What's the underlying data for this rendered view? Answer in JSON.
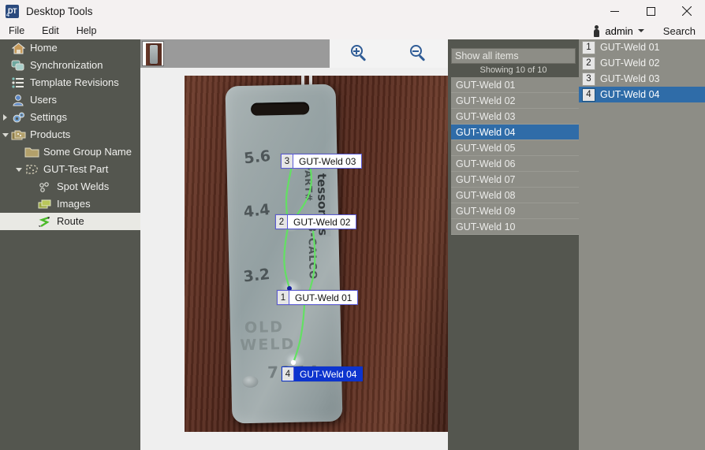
{
  "window": {
    "title": "Desktop Tools",
    "app_icon": "desktop-tools-icon",
    "icon_text": "DT",
    "icon_sub": "4",
    "minimize": "minimize-icon",
    "maximize": "maximize-icon",
    "close": "close-icon"
  },
  "menubar": {
    "items": [
      {
        "label": "File"
      },
      {
        "label": "Edit"
      },
      {
        "label": "Help"
      }
    ],
    "user": "admin",
    "search": "Search"
  },
  "sidebar": {
    "items": [
      {
        "label": "Home",
        "icon": "home-icon",
        "indent": 0,
        "arrow": "none",
        "selected": false
      },
      {
        "label": "Synchronization",
        "icon": "sync-icon",
        "indent": 0,
        "arrow": "none",
        "selected": false
      },
      {
        "label": "Template Revisions",
        "icon": "list-icon",
        "indent": 0,
        "arrow": "none",
        "selected": false
      },
      {
        "label": "Users",
        "icon": "user-icon",
        "indent": 0,
        "arrow": "none",
        "selected": false
      },
      {
        "label": "Settings",
        "icon": "gear-icon",
        "indent": 0,
        "arrow": "right",
        "selected": false
      },
      {
        "label": "Products",
        "icon": "products-icon",
        "indent": 0,
        "arrow": "down",
        "selected": false
      },
      {
        "label": "Some Group Name",
        "icon": "folder-icon",
        "indent": 1,
        "arrow": "none",
        "selected": false
      },
      {
        "label": "GUT-Test Part",
        "icon": "part-icon",
        "indent": 1,
        "arrow": "down",
        "selected": false
      },
      {
        "label": "Spot Welds",
        "icon": "spot-welds-icon",
        "indent": 2,
        "arrow": "none",
        "selected": false
      },
      {
        "label": "Images",
        "icon": "images-icon",
        "indent": 2,
        "arrow": "none",
        "selected": false
      },
      {
        "label": "Route",
        "icon": "route-icon",
        "indent": 2,
        "arrow": "none",
        "selected": true
      }
    ]
  },
  "viewer": {
    "thumbnail_name": "image-thumbnail",
    "zoom_in": "zoom-in-icon",
    "zoom_out": "zoom-out-icon",
    "photo": {
      "description": "metal-tag-photo",
      "stamped_numbers": [
        "5.6",
        "4.4",
        "3.2"
      ],
      "stamped_text_1": "OLD",
      "stamped_text_2": "WELD",
      "serial": "7254",
      "brand_vertical_1": "PART#",
      "brand_vertical_2": "tessonics",
      "brand_vertical_3": "3-CALCO"
    },
    "weld_labels": [
      {
        "index": "3",
        "name": "GUT-Weld 03",
        "selected": false
      },
      {
        "index": "2",
        "name": "GUT-Weld 02",
        "selected": false
      },
      {
        "index": "1",
        "name": "GUT-Weld 01",
        "selected": false
      },
      {
        "index": "4",
        "name": "GUT-Weld 04",
        "selected": true
      }
    ]
  },
  "list_panel": {
    "filter_value": "",
    "filter_placeholder": "Show all items",
    "filter_dropdown": "dropdown-arrow-icon",
    "showing": "Showing 10 of 10",
    "items": [
      {
        "label": "GUT-Weld 01",
        "selected": false
      },
      {
        "label": "GUT-Weld 02",
        "selected": false
      },
      {
        "label": "GUT-Weld 03",
        "selected": false
      },
      {
        "label": "GUT-Weld 04",
        "selected": true
      },
      {
        "label": "GUT-Weld 05",
        "selected": false
      },
      {
        "label": "GUT-Weld 06",
        "selected": false
      },
      {
        "label": "GUT-Weld 07",
        "selected": false
      },
      {
        "label": "GUT-Weld 08",
        "selected": false
      },
      {
        "label": "GUT-Weld 09",
        "selected": false
      },
      {
        "label": "GUT-Weld 10",
        "selected": false
      }
    ]
  },
  "route_panel": {
    "items": [
      {
        "num": "1",
        "label": "GUT-Weld 01",
        "selected": false
      },
      {
        "num": "2",
        "label": "GUT-Weld 02",
        "selected": false
      },
      {
        "num": "3",
        "label": "GUT-Weld 03",
        "selected": false
      },
      {
        "num": "4",
        "label": "GUT-Weld 04",
        "selected": true
      }
    ]
  },
  "colors": {
    "nav_bg": "#54564f",
    "panel_bg": "#8d8d86",
    "selection_blue": "#2f6ca8",
    "label_blue": "#0d34ce",
    "route_green": "#63e063",
    "toolbar_gray": "#9a9a9a"
  }
}
